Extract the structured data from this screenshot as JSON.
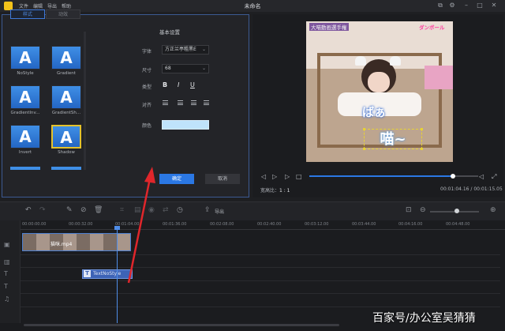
{
  "app": {
    "title": "未命名",
    "menu": [
      "文件",
      "编辑",
      "导出",
      "帮助"
    ]
  },
  "style_panel": {
    "tabs": [
      "样式",
      "动效"
    ],
    "styles": [
      {
        "glyph": "A",
        "label": "NoStyle"
      },
      {
        "glyph": "A",
        "label": "Gradient"
      },
      {
        "glyph": "A",
        "label": "GradientInv..."
      },
      {
        "glyph": "A",
        "label": "GradientSh..."
      },
      {
        "glyph": "A",
        "label": "Invert"
      },
      {
        "glyph": "A",
        "label": "Shadow"
      }
    ],
    "settings": {
      "title": "基本设置",
      "font_label": "字体",
      "font_value": "方正兰亭粗黑E",
      "size_label": "尺寸",
      "size_value": "68",
      "type_label": "类型",
      "bold": "B",
      "italic": "I",
      "underline": "U",
      "align_label": "对齐",
      "color_label": "颜色",
      "color_value": "#bfe3fb"
    },
    "ok_label": "确定",
    "cancel_label": "取消"
  },
  "preview": {
    "caption_top_left": "大喵動画選手権",
    "caption_top_right": "ダンボール",
    "jp_text": "ばぁ",
    "overlay_text": "喵~",
    "ratio_label": "宽高比：",
    "ratio_value": "1 : 1",
    "time": "00:01:04.16 / 00:01:15.05",
    "progress": 0.85
  },
  "toolbar": {
    "export_label": "导出",
    "zoom": 0.55
  },
  "timeline": {
    "ticks": [
      "00:00:00.00",
      "00:00:32.00",
      "00:01:04.00",
      "00:01:36.00",
      "00:02:08.00",
      "00:02:40.00",
      "00:03:12.00",
      "00:03:44.00",
      "00:04:16.00",
      "00:04:48.00"
    ],
    "video_clip_label": "猫咪.mp4",
    "text_clip_label": "TextNoStyle"
  },
  "watermark": "百家号/办公室吴猜猜",
  "colors": {
    "accent": "#2b78e4",
    "selection": "#e4c22c",
    "arrow": "#e0262b"
  }
}
